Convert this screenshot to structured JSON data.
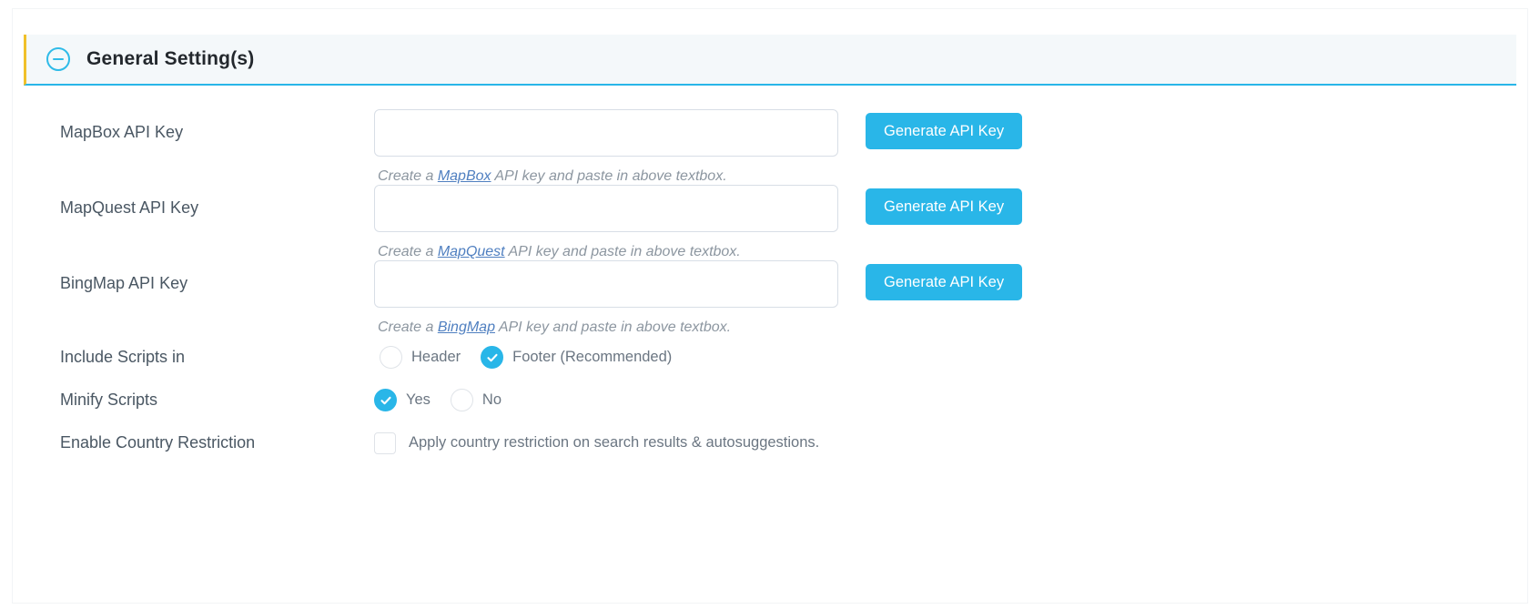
{
  "section": {
    "title": "General Setting(s)",
    "toggle_icon": "minus-circle-icon",
    "accent_color": "#29b6e8",
    "edge_accent_color": "#f0c02a",
    "header_bg": "#f4f8fa"
  },
  "fields": {
    "mapbox": {
      "label": "MapBox API Key",
      "value": "",
      "placeholder": "",
      "help_prefix": "Create a ",
      "help_link": "MapBox",
      "help_suffix": " API key and paste in above textbox.",
      "button_label": "Generate API Key"
    },
    "mapquest": {
      "label": "MapQuest API Key",
      "value": "",
      "placeholder": "",
      "help_prefix": "Create a ",
      "help_link": "MapQuest",
      "help_suffix": " API key and paste in above textbox.",
      "button_label": "Generate API Key"
    },
    "bingmap": {
      "label": "BingMap API Key",
      "value": "",
      "placeholder": "",
      "help_prefix": "Create a ",
      "help_link": "BingMap",
      "help_suffix": " API key and paste in above textbox.",
      "button_label": "Generate API Key"
    },
    "include_scripts": {
      "label": "Include Scripts in",
      "options": [
        {
          "label": "Header",
          "selected": false
        },
        {
          "label": "Footer (Recommended)",
          "selected": true
        }
      ]
    },
    "minify_scripts": {
      "label": "Minify Scripts",
      "options": [
        {
          "label": "Yes",
          "selected": true
        },
        {
          "label": "No",
          "selected": false
        }
      ]
    },
    "country_restriction": {
      "label": "Enable Country Restriction",
      "checkbox_label": "Apply country restriction on search results & autosuggestions.",
      "checked": false
    }
  }
}
